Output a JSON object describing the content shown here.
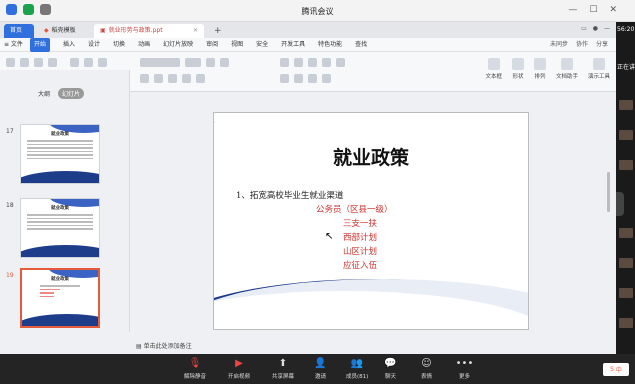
{
  "window": {
    "title": "腾讯会议"
  },
  "tabs": {
    "home": "首页",
    "template": "稻壳模板",
    "doc": "就业形势与政策.ppt",
    "plus": "+"
  },
  "menu": {
    "file": "≡ 文件",
    "items": [
      "开始",
      "插入",
      "设计",
      "切换",
      "动画",
      "幻灯片放映",
      "审阅",
      "视图",
      "安全",
      "开发工具",
      "特色功能",
      "查找"
    ],
    "right": [
      "未同步",
      "协作",
      "分享"
    ]
  },
  "ribbon_right": [
    "文本框",
    "形状",
    "排列",
    "文档助手",
    "演示工具"
  ],
  "panel": {
    "view_tabs": [
      "大纲",
      "幻灯片"
    ],
    "slides": [
      {
        "num": "17",
        "title": "就业政策"
      },
      {
        "num": "18",
        "title": "就业政策"
      },
      {
        "num": "19",
        "title": "就业政策"
      }
    ]
  },
  "notes_hint": "单击此处添加备注",
  "slide": {
    "title": "就业政策",
    "item1": "1、拓宽高校毕业生就业渠道",
    "subitems": [
      "公务员（区县一级）",
      "三支一扶",
      "西部计划",
      "山区计划",
      "应征入伍"
    ]
  },
  "strip": {
    "clock": "56:20",
    "talking": "正在讲"
  },
  "meeting_toolbar": [
    {
      "label": "解除静音",
      "icon": "mic-muted-icon"
    },
    {
      "label": "开启视频",
      "icon": "camera-off-icon"
    },
    {
      "label": "共享屏幕",
      "icon": "share-screen-icon"
    },
    {
      "label": "邀请",
      "icon": "invite-icon"
    },
    {
      "label": "成员(81)",
      "icon": "members-icon"
    },
    {
      "label": "聊天",
      "icon": "chat-icon"
    },
    {
      "label": "表情",
      "icon": "emoji-icon"
    },
    {
      "label": "更多",
      "icon": "more-icon"
    }
  ],
  "ime": "中",
  "colors": {
    "accent": "#2f6fde",
    "red": "#d0312d",
    "slide_blue": "#1d3a8c"
  }
}
